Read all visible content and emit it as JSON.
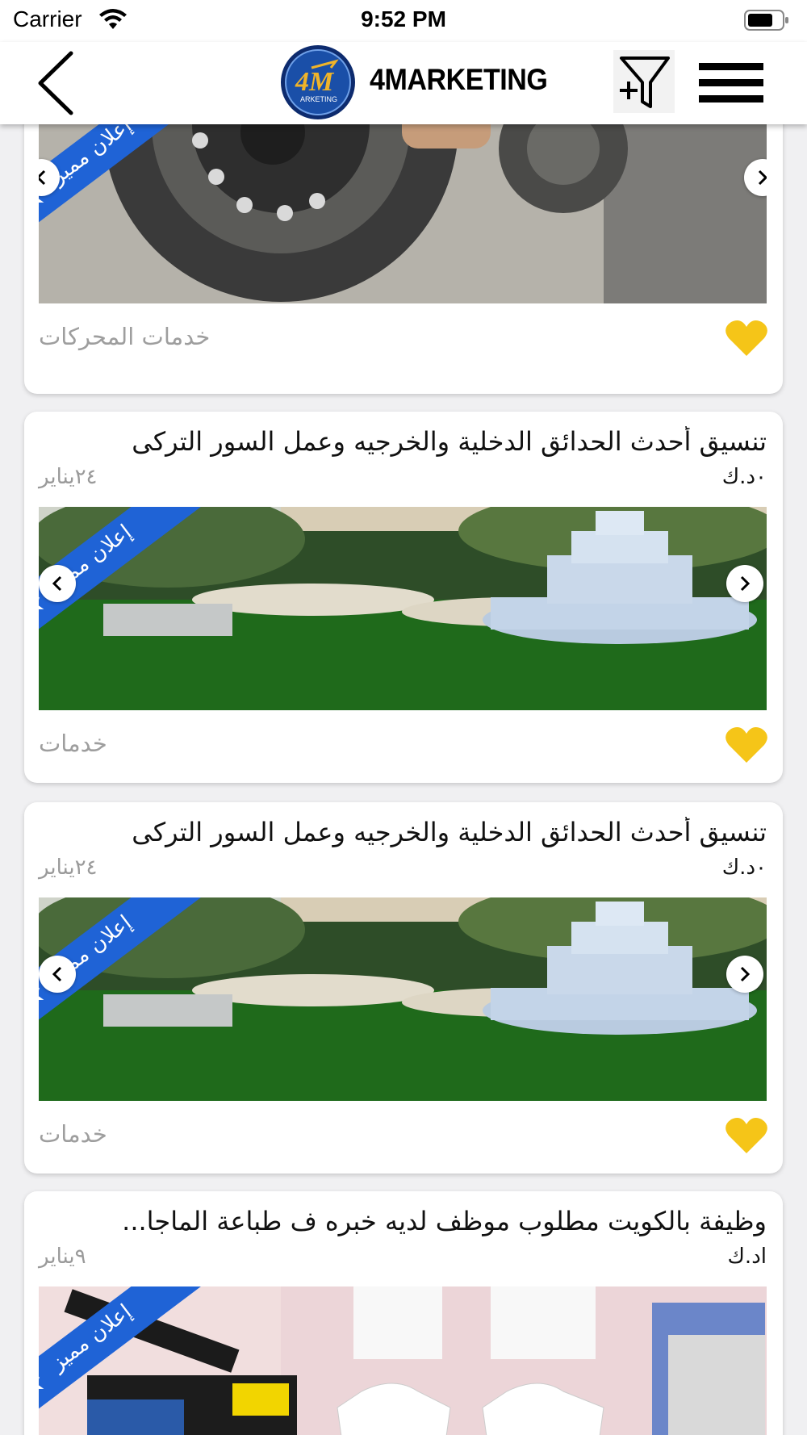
{
  "status_bar": {
    "carrier": "Carrier",
    "time": "9:52 PM"
  },
  "navbar": {
    "brand": "4MARKETING",
    "logo_text": "ARKETING"
  },
  "featured_label": "إعلان مميز",
  "cards": [
    {
      "title": "",
      "price": "",
      "date": "",
      "category": "خدمات المحركات",
      "image": "car-tire"
    },
    {
      "title": "تنسيق أحدث الحدائق الدخلية والخرجيه وعمل السور التركى",
      "price": "٠د.ك",
      "date": "٢٤يناير",
      "category": "خدمات",
      "image": "garden-fountain"
    },
    {
      "title": "تنسيق أحدث الحدائق الدخلية والخرجيه وعمل السور التركى",
      "price": "٠د.ك",
      "date": "٢٤يناير",
      "category": "خدمات",
      "image": "garden-fountain"
    },
    {
      "title": "وظيفة بالكويت مطلوب موظف لديه خبره ف طباعة الماجا...",
      "price": "اد.ك",
      "date": "٩يناير",
      "category": "",
      "image": "tshirt-press"
    }
  ],
  "colors": {
    "ribbon": "#1f63d6",
    "heart": "#f5c518",
    "muted_text": "#9e9e9e"
  },
  "icons": [
    "back-icon",
    "filter-add-icon",
    "menu-icon",
    "heart-icon",
    "chevron-left-icon",
    "chevron-right-icon",
    "star-icon"
  ]
}
